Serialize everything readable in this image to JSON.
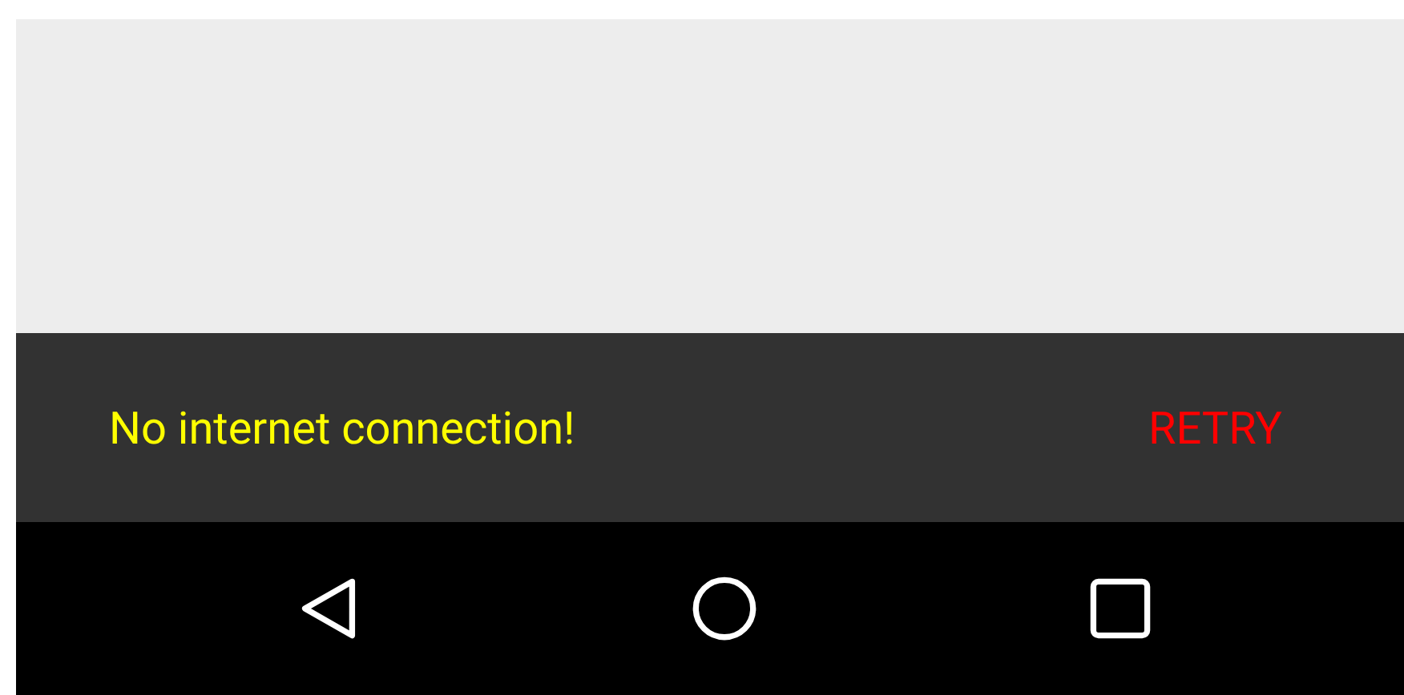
{
  "snackbar": {
    "message": "No internet connection!",
    "action": "RETRY"
  },
  "nav_bar": {
    "buttons": [
      {
        "kind": "back"
      },
      {
        "kind": "home"
      },
      {
        "kind": "recents"
      }
    ]
  }
}
